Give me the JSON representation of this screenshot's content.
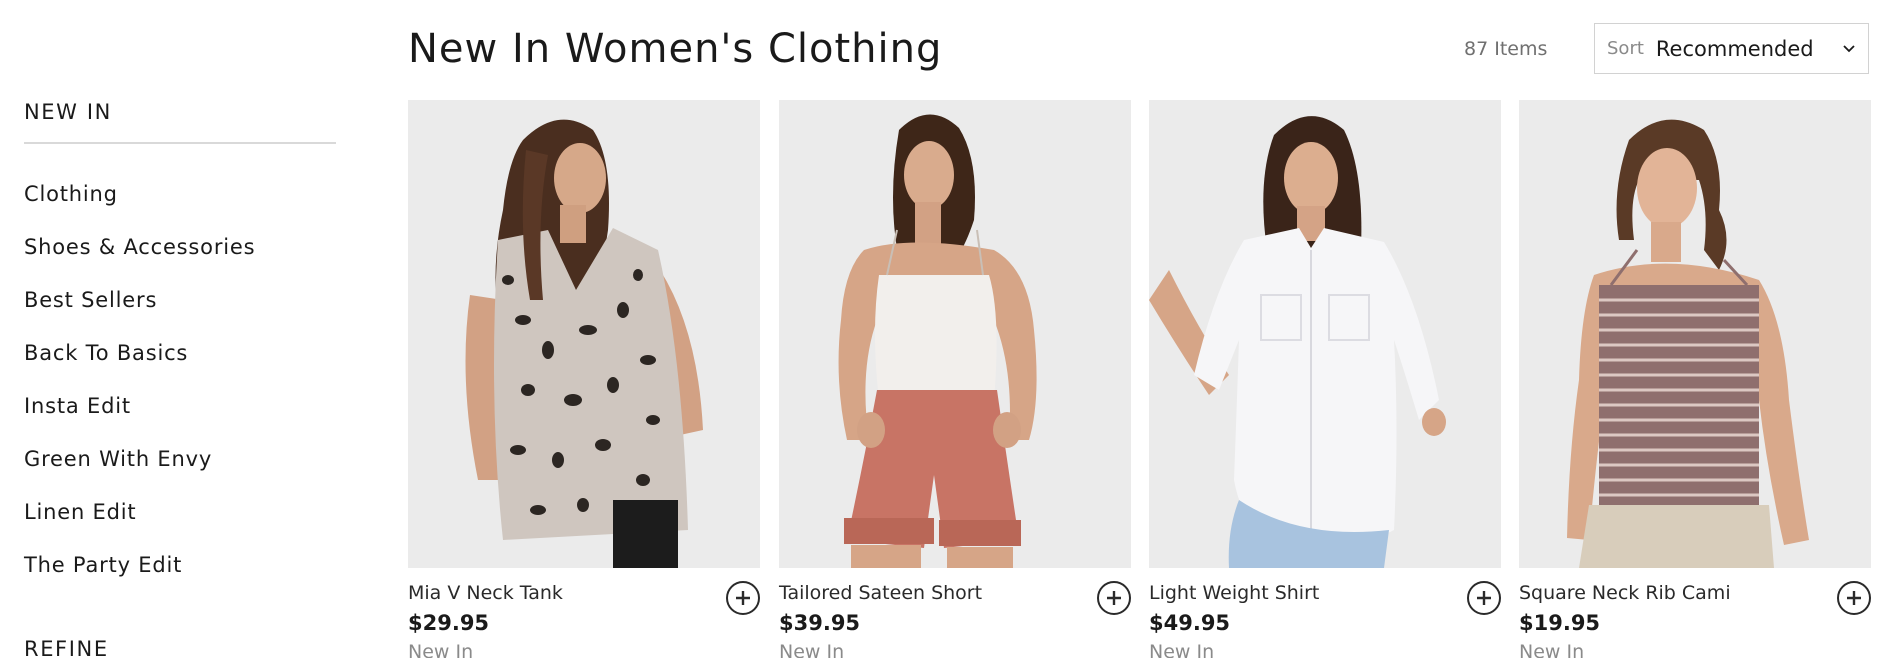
{
  "sidebar": {
    "heading": "NEW IN",
    "items": [
      {
        "label": "Clothing"
      },
      {
        "label": "Shoes & Accessories"
      },
      {
        "label": "Best Sellers"
      },
      {
        "label": "Back To Basics"
      },
      {
        "label": "Insta Edit"
      },
      {
        "label": "Green With Envy"
      },
      {
        "label": "Linen Edit"
      },
      {
        "label": "The Party Edit"
      }
    ],
    "refine_heading": "REFINE"
  },
  "header": {
    "title": "New In Women's Clothing",
    "item_count": "87 Items",
    "sort": {
      "label": "Sort",
      "value": "Recommended",
      "icon": "chevron-down-icon"
    }
  },
  "products": [
    {
      "name": "Mia V Neck Tank",
      "price": "$29.95",
      "tag": "New In",
      "add_icon": "plus-circle-icon"
    },
    {
      "name": "Tailored Sateen Short",
      "price": "$39.95",
      "tag": "New In",
      "add_icon": "plus-circle-icon"
    },
    {
      "name": "Light Weight Shirt",
      "price": "$49.95",
      "tag": "New In",
      "add_icon": "plus-circle-icon"
    },
    {
      "name": "Square Neck Rib Cami",
      "price": "$19.95",
      "tag": "New In",
      "add_icon": "plus-circle-icon"
    }
  ],
  "colors": {
    "text": "#1a1a1a",
    "muted": "#8a8a8a",
    "divider": "#d9d9d9",
    "image_bg": "#e8e8e8"
  }
}
